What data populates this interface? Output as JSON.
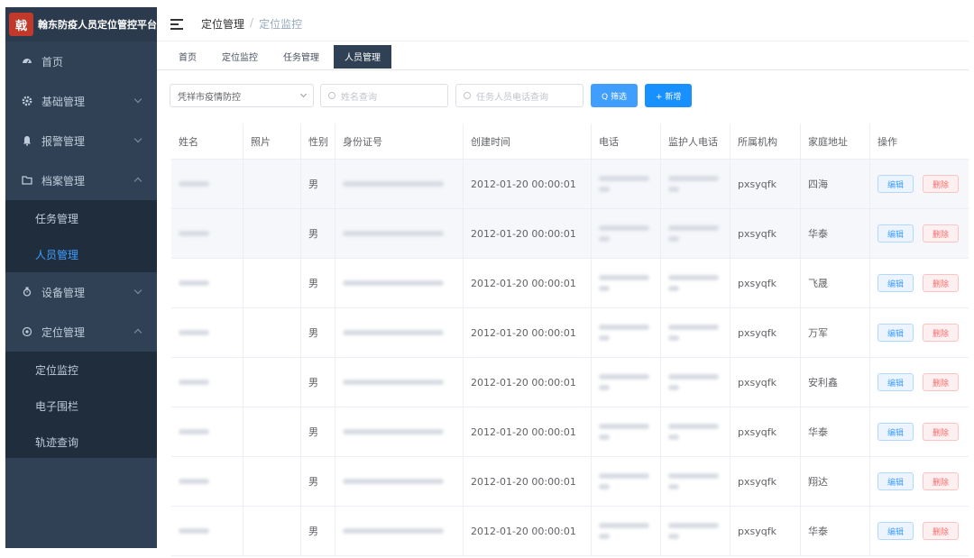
{
  "brand": {
    "logo_text": "戟",
    "title": "翰东防疫人员定位管控平台"
  },
  "sidebar": {
    "items": [
      {
        "label": "首页",
        "icon": "dashboard-icon",
        "expanded": null
      },
      {
        "label": "基础管理",
        "icon": "gear-icon",
        "expanded": false
      },
      {
        "label": "报警管理",
        "icon": "bell-icon",
        "expanded": false
      },
      {
        "label": "档案管理",
        "icon": "folder-icon",
        "expanded": true,
        "children": [
          {
            "label": "任务管理"
          },
          {
            "label": "人员管理"
          }
        ]
      },
      {
        "label": "设备管理",
        "icon": "watch-icon",
        "expanded": false
      },
      {
        "label": "定位管理",
        "icon": "location-icon",
        "expanded": true,
        "children": [
          {
            "label": "定位监控"
          },
          {
            "label": "电子围栏"
          },
          {
            "label": "轨迹查询"
          }
        ]
      }
    ]
  },
  "header": {
    "crumb_parent": "定位管理",
    "crumb_sep": "/",
    "crumb_current": "定位监控"
  },
  "tags": [
    "首页",
    "定位监控",
    "任务管理",
    "人员管理"
  ],
  "filters": {
    "org_select": "凭祥市疫情防控",
    "name_placeholder": "姓名查询",
    "phone_placeholder": "任务人员电话查询",
    "search_btn": "Q 筛选",
    "add_btn": "+ 新增"
  },
  "table": {
    "headers": [
      "姓名",
      "照片",
      "性别",
      "身份证号",
      "创建时间",
      "电话",
      "监护人电话",
      "所属机构",
      "家庭地址",
      "操作"
    ],
    "edit_label": "编辑",
    "delete_label": "删除",
    "rows": [
      {
        "sex": "男",
        "time": "2012-01-20 00:00:01",
        "org": "pxsyqfk",
        "addr": "四海"
      },
      {
        "sex": "男",
        "time": "2012-01-20 00:00:01",
        "org": "pxsyqfk",
        "addr": "华泰"
      },
      {
        "sex": "男",
        "time": "2012-01-20 00:00:01",
        "org": "pxsyqfk",
        "addr": "飞晟"
      },
      {
        "sex": "男",
        "time": "2012-01-20 00:00:01",
        "org": "pxsyqfk",
        "addr": "万军"
      },
      {
        "sex": "男",
        "time": "2012-01-20 00:00:01",
        "org": "pxsyqfk",
        "addr": "安利鑫"
      },
      {
        "sex": "男",
        "time": "2012-01-20 00:00:01",
        "org": "pxsyqfk",
        "addr": "华泰"
      },
      {
        "sex": "男",
        "time": "2012-01-20 00:00:01",
        "org": "pxsyqfk",
        "addr": "翔达"
      },
      {
        "sex": "男",
        "time": "2012-01-20 00:00:01",
        "org": "pxsyqfk",
        "addr": "华泰"
      }
    ]
  }
}
